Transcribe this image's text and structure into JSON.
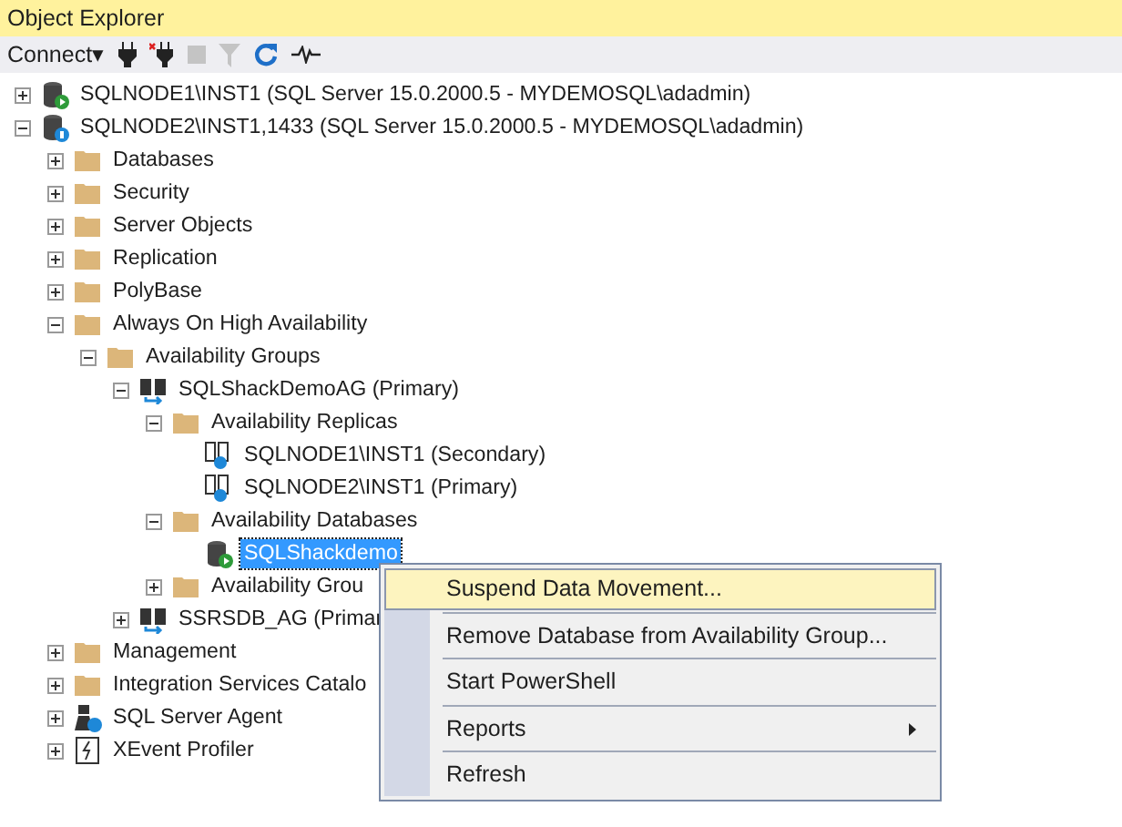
{
  "window": {
    "title": "Object Explorer"
  },
  "toolbar": {
    "connect": "Connect",
    "connect_caret": "▾"
  },
  "tree": [
    {
      "label": "SQLNODE1\\INST1 (SQL Server 15.0.2000.5 - MYDEMOSQL\\adadmin)",
      "kind": "server-green",
      "expanded": false,
      "selected": false
    },
    {
      "label": "SQLNODE2\\INST1,1433 (SQL Server 15.0.2000.5 - MYDEMOSQL\\adadmin)",
      "kind": "server-blue",
      "expanded": true,
      "selected": false,
      "children": [
        {
          "label": "Databases",
          "kind": "folder",
          "expanded": false,
          "selected": false
        },
        {
          "label": "Security",
          "kind": "folder",
          "expanded": false,
          "selected": false
        },
        {
          "label": "Server Objects",
          "kind": "folder",
          "expanded": false,
          "selected": false
        },
        {
          "label": "Replication",
          "kind": "folder",
          "expanded": false,
          "selected": false
        },
        {
          "label": "PolyBase",
          "kind": "folder",
          "expanded": false,
          "selected": false
        },
        {
          "label": "Always On High Availability",
          "kind": "folder",
          "expanded": true,
          "selected": false,
          "children": [
            {
              "label": "Availability Groups",
              "kind": "folder",
              "expanded": true,
              "selected": false,
              "children": [
                {
                  "label": "SQLShackDemoAG (Primary)",
                  "kind": "group",
                  "expanded": true,
                  "selected": false,
                  "children": [
                    {
                      "label": "Availability Replicas",
                      "kind": "folder",
                      "expanded": true,
                      "selected": false,
                      "children": [
                        {
                          "label": "SQLNODE1\\INST1 (Secondary)",
                          "kind": "replica",
                          "selected": false
                        },
                        {
                          "label": "SQLNODE2\\INST1 (Primary)",
                          "kind": "replica",
                          "selected": false
                        }
                      ]
                    },
                    {
                      "label": "Availability Databases",
                      "kind": "folder",
                      "expanded": true,
                      "selected": false,
                      "children": [
                        {
                          "label": "SQLShackdemo",
                          "kind": "database",
                          "selected": true
                        }
                      ]
                    },
                    {
                      "label": "Availability Grou",
                      "kind": "folder",
                      "expanded": false,
                      "selected": false
                    }
                  ]
                },
                {
                  "label": "SSRSDB_AG (Primar",
                  "kind": "group",
                  "expanded": false,
                  "selected": false
                }
              ]
            }
          ]
        },
        {
          "label": "Management",
          "kind": "folder",
          "expanded": false,
          "selected": false
        },
        {
          "label": "Integration Services Catalo",
          "kind": "folder",
          "expanded": false,
          "selected": false
        },
        {
          "label": "SQL Server Agent",
          "kind": "agent",
          "expanded": false,
          "selected": false
        },
        {
          "label": "XEvent Profiler",
          "kind": "xevent",
          "expanded": false,
          "selected": false
        }
      ]
    }
  ],
  "context_menu": [
    {
      "label": "Suspend Data Movement...",
      "selected": true
    },
    {
      "label": "Remove Database from Availability Group...",
      "selected": false
    },
    {
      "label": "Start PowerShell",
      "selected": false
    },
    {
      "label": "Reports",
      "selected": false,
      "submenu": true
    },
    {
      "label": "Refresh",
      "selected": false
    }
  ]
}
